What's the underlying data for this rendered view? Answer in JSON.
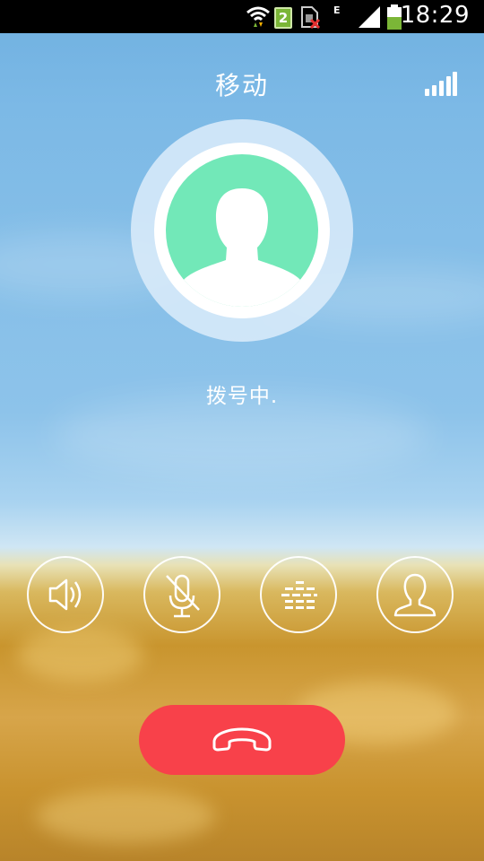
{
  "status_bar": {
    "time": "18:29",
    "sim_number": "2",
    "network_type": "E",
    "icons": [
      "wifi-icon",
      "sim-badge",
      "sim-missing-icon",
      "cell-signal-icon",
      "battery-icon"
    ]
  },
  "call": {
    "carrier": "移动",
    "status": "拨号中.",
    "signal_bars": 5
  },
  "controls": [
    {
      "name": "speaker",
      "icon": "speaker-icon"
    },
    {
      "name": "mute",
      "icon": "microphone-muted-icon"
    },
    {
      "name": "dialpad",
      "icon": "dialpad-icon"
    },
    {
      "name": "contacts",
      "icon": "contact-icon"
    }
  ],
  "hangup": {
    "icon": "hangup-phone-icon"
  },
  "colors": {
    "hangup": "#f8414a",
    "avatar_bg": "#72e8b8",
    "battery": "#7bb637"
  }
}
